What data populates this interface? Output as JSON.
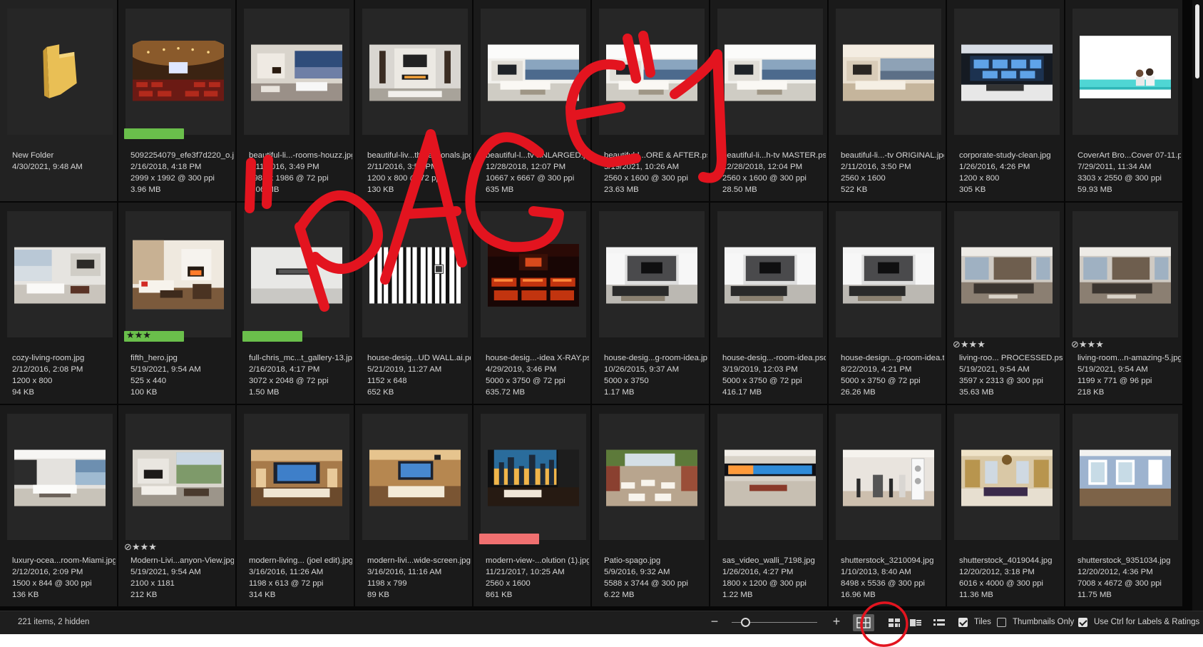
{
  "colors": {
    "label_green": "#6abf4b",
    "label_red": "#f07070",
    "annotation_red": "#e3141f",
    "background": "#070707",
    "cell": "#1a1a1a"
  },
  "items": [
    {
      "name": "New Folder",
      "date": "4/30/2021, 9:48 AM",
      "dims": "",
      "size": "",
      "thumb": "folder-icon",
      "label": "",
      "rating": ""
    },
    {
      "name": "5092254079_efe3f7d220_o.jpg",
      "date": "2/16/2018, 4:18 PM",
      "dims": "2999 x 1992 @ 300 ppi",
      "size": "3.96 MB",
      "thumb": "auditorium",
      "label": "green",
      "rating": ""
    },
    {
      "name": "beautiful-li...-rooms-houzz.jpg",
      "date": "2/11/2016, 3:49 PM",
      "dims": "2986 x 1986 @ 72 ppi",
      "size": "1.06 MB",
      "thumb": "living-dusk",
      "label": "",
      "rating": ""
    },
    {
      "name": "beautiful-liv...th-sectionals.jpg",
      "date": "2/11/2016, 3:50 PM",
      "dims": "1200 x 800 @ 72 ppi",
      "size": "130 KB",
      "thumb": "fireplace-wall",
      "label": "",
      "rating": ""
    },
    {
      "name": "beautiful-l...tv ENLARGED.psd",
      "date": "12/28/2018, 12:07 PM",
      "dims": "10667 x 6667 @ 300 ppi",
      "size": "635 MB",
      "thumb": "bright-living",
      "label": "",
      "rating": ""
    },
    {
      "name": "beautiful-l...ORE & AFTER.psd",
      "date": "5/19/2021, 10:26 AM",
      "dims": "2560 x 1600 @ 300 ppi",
      "size": "23.63 MB",
      "thumb": "bright-living",
      "label": "",
      "rating": ""
    },
    {
      "name": "beautiful-li...h-tv MASTER.psd",
      "date": "12/28/2018, 12:04 PM",
      "dims": "2560 x 1600 @ 300 ppi",
      "size": "28.50 MB",
      "thumb": "bright-living",
      "label": "",
      "rating": ""
    },
    {
      "name": "beautiful-li...-tv ORIGINAL.jpg",
      "date": "2/11/2016, 3:50 PM",
      "dims": "2560 x 1600",
      "size": "522 KB",
      "thumb": "warm-living",
      "label": "",
      "rating": ""
    },
    {
      "name": "corporate-study-clean.jpg",
      "date": "1/26/2016, 4:26 PM",
      "dims": "1200 x 800",
      "size": "305 KB",
      "thumb": "corporate",
      "label": "",
      "rating": ""
    },
    {
      "name": "CoverArt Bro...Cover 07-11.psd",
      "date": "7/29/2011, 11:34 AM",
      "dims": "3303 x 2550 @ 300 ppi",
      "size": "59.93 MB",
      "thumb": "coverart",
      "label": "",
      "rating": ""
    },
    {
      "name": "cozy-living-room.jpg",
      "date": "2/12/2016, 2:08 PM",
      "dims": "1200 x 800",
      "size": "94 KB",
      "thumb": "cozy",
      "label": "",
      "rating": ""
    },
    {
      "name": "fifth_hero.jpg",
      "date": "5/19/2021, 9:54 AM",
      "dims": "525 x 440",
      "size": "100 KB",
      "thumb": "fifth",
      "label": "green",
      "rating": "★★★"
    },
    {
      "name": "full-chris_mc...t_gallery-13.jpg",
      "date": "2/16/2018, 4:17 PM",
      "dims": "3072 x 2048 @ 72 ppi",
      "size": "1.50 MB",
      "thumb": "white-wall",
      "label": "green",
      "rating": ""
    },
    {
      "name": "house-desig...UD WALL.ai.pdf",
      "date": "5/21/2019, 11:27 AM",
      "dims": "1152 x 648",
      "size": "652 KB",
      "thumb": "stripes",
      "label": "",
      "rating": ""
    },
    {
      "name": "house-desig...-idea X-RAY.psd",
      "date": "4/29/2019, 3:46 PM",
      "dims": "5000 x 3750 @ 72 ppi",
      "size": "635.72 MB",
      "thumb": "xray",
      "label": "",
      "rating": ""
    },
    {
      "name": "house-desig...g-room-idea.jpg",
      "date": "10/26/2015, 9:37 AM",
      "dims": "5000 x 3750",
      "size": "1.17 MB",
      "thumb": "grey-living",
      "label": "",
      "rating": ""
    },
    {
      "name": "house-desig...-room-idea.psd",
      "date": "3/19/2019, 12:03 PM",
      "dims": "5000 x 3750 @ 72 ppi",
      "size": "416.17 MB",
      "thumb": "grey-living",
      "label": "",
      "rating": ""
    },
    {
      "name": "house-design...g-room-idea.tif",
      "date": "8/22/2019, 4:21 PM",
      "dims": "5000 x 3750 @ 72 ppi",
      "size": "26.26 MB",
      "thumb": "grey-living",
      "label": "",
      "rating": ""
    },
    {
      "name": "living-roo... PROCESSED.psd",
      "date": "5/19/2021, 9:54 AM",
      "dims": "3597 x 2313 @ 300 ppi",
      "size": "35.63 MB",
      "thumb": "dark-sofa",
      "label": "",
      "rating": "⊘★★★"
    },
    {
      "name": "living-room...n-amazing-5.jpg",
      "date": "5/19/2021, 9:54 AM",
      "dims": "1199 x 771 @ 96 ppi",
      "size": "218 KB",
      "thumb": "dark-sofa",
      "label": "",
      "rating": "⊘★★★"
    },
    {
      "name": "luxury-ocea...room-Miami.jpg",
      "date": "2/12/2016, 2:09 PM",
      "dims": "1500 x 844 @ 300 ppi",
      "size": "136 KB",
      "thumb": "miami",
      "label": "",
      "rating": ""
    },
    {
      "name": "Modern-Livi...anyon-View.jpg",
      "date": "5/19/2021, 9:54 AM",
      "dims": "2100 x 1181",
      "size": "212 KB",
      "thumb": "canyon",
      "label": "",
      "rating": "⊘★★★"
    },
    {
      "name": "modern-living... (joel edit).jpg",
      "date": "3/16/2016, 11:26 AM",
      "dims": "1198 x 613 @ 72 ppi",
      "size": "314 KB",
      "thumb": "theater-warm",
      "label": "",
      "rating": ""
    },
    {
      "name": "modern-livi...wide-screen.jpg",
      "date": "3/16/2016, 11:16 AM",
      "dims": "1198 x 799",
      "size": "89 KB",
      "thumb": "theater-warm2",
      "label": "",
      "rating": ""
    },
    {
      "name": "modern-view-...olution (1).jpg",
      "date": "11/21/2017, 10:25 AM",
      "dims": "2560 x 1600",
      "size": "861 KB",
      "thumb": "city-view",
      "label": "red",
      "rating": ""
    },
    {
      "name": "Patio-spago.jpg",
      "date": "5/9/2016, 9:32 AM",
      "dims": "5588 x 3744 @ 300 ppi",
      "size": "6.22 MB",
      "thumb": "patio",
      "label": "",
      "rating": ""
    },
    {
      "name": "sas_video_walli_7198.jpg",
      "date": "1/26/2016, 4:27 PM",
      "dims": "1800 x 1200 @ 300 ppi",
      "size": "1.22 MB",
      "thumb": "videowall",
      "label": "",
      "rating": ""
    },
    {
      "name": "shutterstock_3210094.jpg",
      "date": "1/10/2013, 8:40 AM",
      "dims": "8498 x 5536 @ 300 ppi",
      "size": "16.96 MB",
      "thumb": "speakers",
      "label": "",
      "rating": ""
    },
    {
      "name": "shutterstock_4019044.jpg",
      "date": "12/20/2012, 3:18 PM",
      "dims": "6016 x 4000 @ 300 ppi",
      "size": "11.36 MB",
      "thumb": "chandelier",
      "label": "",
      "rating": ""
    },
    {
      "name": "shutterstock_9351034.jpg",
      "date": "12/20/2012, 4:36 PM",
      "dims": "7008 x 4672 @ 300 ppi",
      "size": "11.75 MB",
      "thumb": "blue-room",
      "label": "",
      "rating": ""
    }
  ],
  "status": {
    "count_text": "221 items, 2 hidden",
    "zoom_minus": "−",
    "zoom_plus": "+",
    "tiles_label": "Tiles",
    "thumbs_only_label": "Thumbnails Only",
    "ctrl_label": "Use Ctrl for Labels & Ratings",
    "view_icons": [
      "grid-view-icon",
      "compact-grid-icon",
      "details-view-icon",
      "list-view-icon"
    ]
  },
  "annotation": {
    "text": "\"PAGE 1",
    "circle_target": "grid-view-icon"
  }
}
